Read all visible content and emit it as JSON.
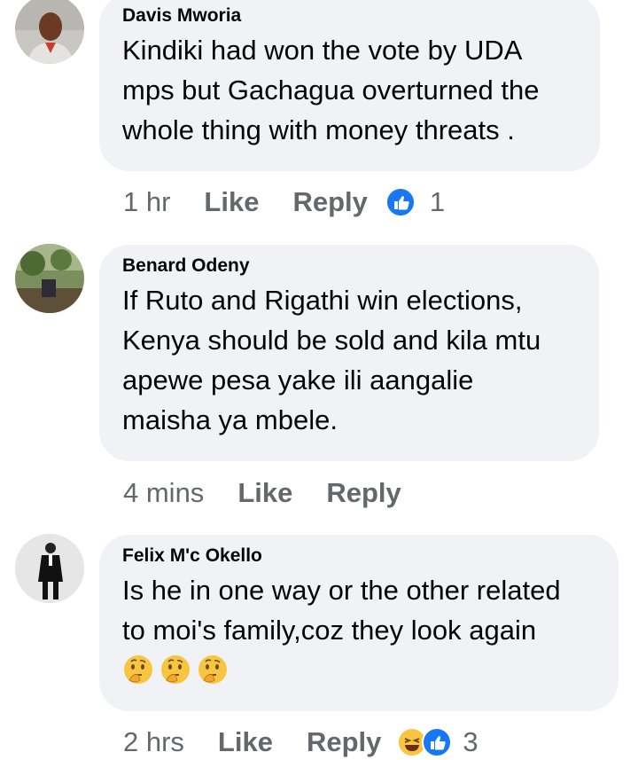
{
  "comments": [
    {
      "author": "Davis Mworia",
      "text": "Kindiki had won the vote by UDA mps but Gachagua overturned the whole thing with money threats .",
      "text_lines": [
        "Kindiki had won the vote by UDA",
        "mps but Gachagua overturned the",
        "whole thing with money threats ."
      ],
      "time": "1 hr",
      "like_label": "Like",
      "reply_label": "Reply",
      "reaction_count": "1",
      "reactions": [
        "like-icon"
      ]
    },
    {
      "author": "Benard Odeny",
      "text_lines": [
        "If Ruto and Rigathi win elections,",
        "Kenya should be sold and kila mtu",
        "apewe pesa yake ili aangalie",
        "maisha ya mbele."
      ],
      "time": "4 mins",
      "like_label": "Like",
      "reply_label": "Reply"
    },
    {
      "author": "Felix M'c Okello",
      "text_lines": [
        "Is he in one way or the other related",
        "to moi's family,coz they look again"
      ],
      "emojis": [
        "thinking-face-icon",
        "thinking-face-icon",
        "thinking-face-icon"
      ],
      "time": "2 hrs",
      "like_label": "Like",
      "reply_label": "Reply",
      "reaction_count": "3",
      "reactions": [
        "haha-icon",
        "like-icon"
      ]
    }
  ],
  "colors": {
    "bubble": "#f0f2f5",
    "meta_text": "#65676b",
    "like_blue": "#1877f2",
    "haha_yellow": "#f7c540"
  }
}
